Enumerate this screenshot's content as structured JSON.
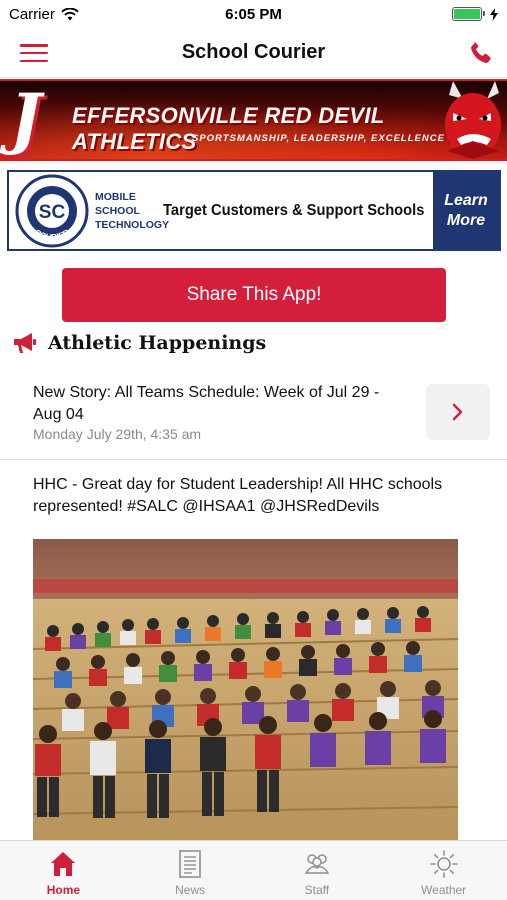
{
  "status_bar": {
    "carrier": "Carrier",
    "time": "6:05 PM",
    "battery_level": 1.0,
    "icons": [
      "wifi-icon",
      "battery-icon",
      "charging-bolt-icon"
    ]
  },
  "nav": {
    "title": "School Courier",
    "left_icon": "hamburger-menu-icon",
    "right_icon": "phone-icon",
    "accent_color": "#cf1f3a"
  },
  "banner_rd": {
    "title": "EFFERSONVILLE RED DEVIL ATHLETICS",
    "letter": "J",
    "subtitle": "SPORTSMANSHIP, LEADERSHIP, EXCELLENCE"
  },
  "banner_sc": {
    "logo_top": "SCHOOL",
    "logo_mid": "SC",
    "logo_bottom": "COURIER",
    "tag_lines": [
      "MOBILE",
      "SCHOOL",
      "TECHNOLOGY"
    ],
    "headline": "Target Customers & Support Schools",
    "cta": "Learn More",
    "brand_color": "#1f3672"
  },
  "share_button": {
    "label": "Share This App!",
    "color": "#d31f3c"
  },
  "section": {
    "title": "Athletic Happenings",
    "icon": "megaphone-icon"
  },
  "feed": [
    {
      "headline": "New Story: All Teams Schedule: Week of Jul 29 - Aug 04",
      "date": "Monday July 29th, 4:35 am",
      "action_icon": "chevron-right-icon"
    },
    {
      "headline": "HHC - Great day for Student Leadership! All HHC schools represented! #SALC @IHSAA1 @JHSRedDevils",
      "image": "photo of students seated on gym bleachers"
    }
  ],
  "tabs": [
    {
      "label": "Home",
      "icon": "home-icon",
      "active": true
    },
    {
      "label": "News",
      "icon": "news-icon",
      "active": false
    },
    {
      "label": "Staff",
      "icon": "staff-icon",
      "active": false
    },
    {
      "label": "Weather",
      "icon": "weather-sun-icon",
      "active": false
    }
  ]
}
